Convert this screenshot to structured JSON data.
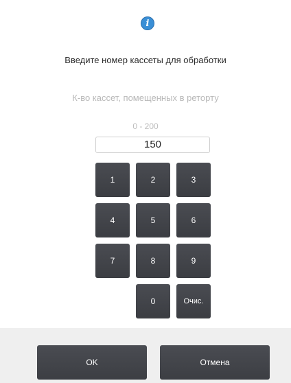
{
  "dialog": {
    "icon": "info-icon",
    "icon_glyph": "i",
    "prompt": "Введите номер кассеты для обработки",
    "subprompt": "К-во кассет, помещенных в реторту",
    "range": "0 - 200",
    "value": "150"
  },
  "keypad": {
    "keys": [
      "1",
      "2",
      "3",
      "4",
      "5",
      "6",
      "7",
      "8",
      "9",
      "0"
    ],
    "clear_label": "Очис."
  },
  "footer": {
    "ok_label": "OK",
    "cancel_label": "Отмена"
  },
  "colors": {
    "key_bg": "#434549",
    "footer_bg": "#efefef",
    "info_blue": "#3a8fd6"
  }
}
